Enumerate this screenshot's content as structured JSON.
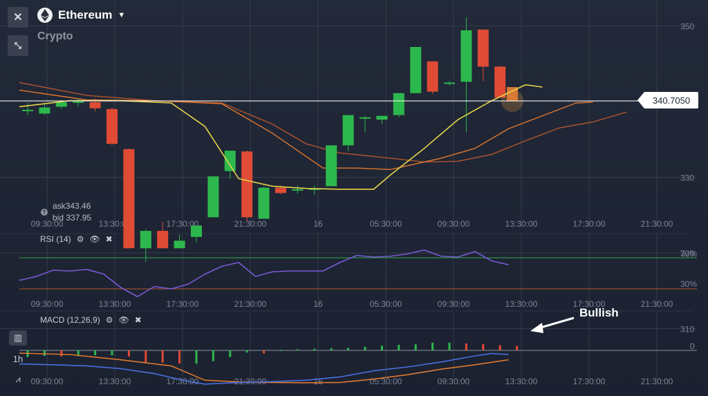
{
  "asset": {
    "name": "Ethereum",
    "category": "Crypto"
  },
  "toolbar": {
    "close_icon": "close-icon",
    "collapse_icon": "collapse-arrows-icon"
  },
  "quotes": {
    "ask": "ask343.46",
    "bid": "bid 337.95"
  },
  "current_price": "340.7050",
  "price_axis": {
    "ticks": [
      "350",
      "340",
      "330",
      "320",
      "310"
    ]
  },
  "time_axis": {
    "labels": [
      "09:30:00",
      "13:30:00",
      "17:30:00",
      "21:30:00",
      "16",
      "05:30:00",
      "09:30:00",
      "13:30:00",
      "17:30:00",
      "21:30:00"
    ]
  },
  "rsi": {
    "title": "RSI (14)",
    "levels": [
      "70%",
      "30%"
    ],
    "line_color": "#7a5ad6"
  },
  "macd": {
    "title": "MACD (12,26,9)",
    "zero_label": "0"
  },
  "annotation": {
    "text": "Bullish"
  },
  "sidebar": {
    "timeframe": "1h"
  },
  "colors": {
    "up": "#2db84d",
    "down": "#e04b35",
    "yellow": "#e6d44a",
    "orange": "#e0782f",
    "blue": "#4a6fe0"
  },
  "chart_data": {
    "type": "candlestick",
    "candles": [
      {
        "o": 339.0,
        "h": 340.0,
        "c": 339.1,
        "l": 338.4
      },
      {
        "o": 338.6,
        "h": 339.9,
        "c": 339.4,
        "l": 338.4
      },
      {
        "o": 339.5,
        "h": 340.4,
        "c": 340.1,
        "l": 339.2
      },
      {
        "o": 340.2,
        "h": 340.6,
        "c": 340.2,
        "l": 339.6
      },
      {
        "o": 340.1,
        "h": 340.6,
        "c": 339.3,
        "l": 338.9
      },
      {
        "o": 339.2,
        "h": 339.4,
        "c": 334.6,
        "l": 334.4
      },
      {
        "o": 333.9,
        "h": 334.0,
        "c": 320.8,
        "l": 320.8
      },
      {
        "o": 320.8,
        "h": 323.3,
        "c": 323.1,
        "l": 319.0
      },
      {
        "o": 323.1,
        "h": 324.3,
        "c": 320.8,
        "l": 320.8
      },
      {
        "o": 320.8,
        "h": 322.6,
        "c": 321.8,
        "l": 320.8
      },
      {
        "o": 322.3,
        "h": 323.8,
        "c": 323.8,
        "l": 321.6
      },
      {
        "o": 324.9,
        "h": 330.3,
        "c": 330.3,
        "l": 324.9
      },
      {
        "o": 331.0,
        "h": 333.7,
        "c": 333.7,
        "l": 330.0
      },
      {
        "o": 333.6,
        "h": 333.7,
        "c": 324.9,
        "l": 324.4
      },
      {
        "o": 324.7,
        "h": 329.0,
        "c": 328.8,
        "l": 324.7
      },
      {
        "o": 328.8,
        "h": 329.1,
        "c": 328.1,
        "l": 327.9
      },
      {
        "o": 328.5,
        "h": 329.1,
        "c": 328.6,
        "l": 328.0
      },
      {
        "o": 328.7,
        "h": 329.1,
        "c": 328.7,
        "l": 327.9
      },
      {
        "o": 329.0,
        "h": 334.4,
        "c": 334.4,
        "l": 329.0
      },
      {
        "o": 334.4,
        "h": 338.4,
        "c": 338.4,
        "l": 333.6
      },
      {
        "o": 338.1,
        "h": 338.3,
        "c": 338.1,
        "l": 336.1
      },
      {
        "o": 337.8,
        "h": 338.3,
        "c": 338.3,
        "l": 337.2
      },
      {
        "o": 338.4,
        "h": 341.3,
        "c": 341.3,
        "l": 338.1
      },
      {
        "o": 341.3,
        "h": 347.4,
        "c": 347.4,
        "l": 341.3
      },
      {
        "o": 345.5,
        "h": 345.5,
        "c": 341.5,
        "l": 341.2
      },
      {
        "o": 342.7,
        "h": 342.9,
        "c": 342.7,
        "l": 342.3
      },
      {
        "o": 342.8,
        "h": 351.3,
        "c": 349.6,
        "l": 336.1
      },
      {
        "o": 349.7,
        "h": 349.7,
        "c": 344.8,
        "l": 342.9
      },
      {
        "o": 344.8,
        "h": 344.9,
        "c": 340.7,
        "l": 340.7
      }
    ],
    "ma_fast": [
      [
        0,
        339.5
      ],
      [
        3,
        340.3
      ],
      [
        6,
        340.3
      ],
      [
        9,
        340.0
      ],
      [
        11,
        336.9
      ],
      [
        13,
        330.0
      ],
      [
        15,
        329.0
      ],
      [
        17,
        328.7
      ],
      [
        19,
        328.6
      ],
      [
        21,
        328.6
      ],
      [
        22,
        330.5
      ],
      [
        24,
        334.0
      ],
      [
        26,
        337.8
      ],
      [
        28,
        340.3
      ],
      [
        30,
        342.4
      ],
      [
        31,
        342.1
      ]
    ],
    "ma_mid": [
      [
        0,
        341.7
      ],
      [
        4,
        340.4
      ],
      [
        8,
        340.3
      ],
      [
        12,
        339.9
      ],
      [
        15,
        336.0
      ],
      [
        18,
        331.4
      ],
      [
        20,
        331.4
      ],
      [
        22,
        331.2
      ],
      [
        25,
        332.7
      ],
      [
        27,
        334.0
      ],
      [
        29,
        336.6
      ],
      [
        31,
        338.3
      ],
      [
        33,
        340.0
      ],
      [
        34,
        340.1
      ]
    ],
    "ma_slow": [
      [
        0,
        342.7
      ],
      [
        4,
        341.0
      ],
      [
        8,
        340.3
      ],
      [
        12,
        340.0
      ],
      [
        15,
        337.2
      ],
      [
        17,
        334.6
      ],
      [
        19,
        333.4
      ],
      [
        22,
        332.7
      ],
      [
        24,
        332.2
      ],
      [
        26,
        332.3
      ],
      [
        28,
        333.2
      ],
      [
        30,
        335.0
      ],
      [
        32,
        336.7
      ],
      [
        34,
        337.5
      ],
      [
        36,
        338.8
      ]
    ],
    "rsi_values": [
      [
        0,
        41
      ],
      [
        1,
        46
      ],
      [
        2,
        54
      ],
      [
        3,
        53
      ],
      [
        4,
        55
      ],
      [
        5,
        49
      ],
      [
        6,
        32
      ],
      [
        7,
        20
      ],
      [
        8,
        33
      ],
      [
        9,
        30
      ],
      [
        10,
        36
      ],
      [
        11,
        49
      ],
      [
        12,
        59
      ],
      [
        13,
        64
      ],
      [
        14,
        46
      ],
      [
        15,
        52
      ],
      [
        16,
        53
      ],
      [
        17,
        53
      ],
      [
        18,
        53
      ],
      [
        19,
        64
      ],
      [
        20,
        73
      ],
      [
        21,
        71
      ],
      [
        22,
        72
      ],
      [
        23,
        75
      ],
      [
        24,
        80
      ],
      [
        25,
        72
      ],
      [
        26,
        71
      ],
      [
        27,
        78
      ],
      [
        28,
        66
      ],
      [
        29,
        61
      ]
    ],
    "macd_line": [
      [
        0,
        -4.9
      ],
      [
        2,
        -5.2
      ],
      [
        4,
        -5.6
      ],
      [
        6,
        -6.6
      ],
      [
        8,
        -8.4
      ],
      [
        10,
        -11.2
      ],
      [
        11,
        -12.2
      ],
      [
        13,
        -11.6
      ],
      [
        15,
        -11.3
      ],
      [
        17,
        -10.8
      ],
      [
        19,
        -9.6
      ],
      [
        21,
        -7.4
      ],
      [
        23,
        -6.0
      ],
      [
        25,
        -4.2
      ],
      [
        27,
        -2.0
      ],
      [
        28,
        -1.1
      ],
      [
        29,
        -1.5
      ]
    ],
    "signal_line": [
      [
        0,
        -1.0
      ],
      [
        3,
        -1.5
      ],
      [
        6,
        -3.4
      ],
      [
        9,
        -5.6
      ],
      [
        11,
        -10.8
      ],
      [
        13,
        -11.4
      ],
      [
        15,
        -11.6
      ],
      [
        17,
        -11.7
      ],
      [
        19,
        -11.6
      ],
      [
        21,
        -10.4
      ],
      [
        23,
        -8.8
      ],
      [
        25,
        -6.8
      ],
      [
        27,
        -5.2
      ],
      [
        29,
        -3.4
      ]
    ],
    "histogram": [
      -2.4,
      -2.0,
      -2.2,
      -2.1,
      -1.8,
      -1.8,
      -2.2,
      -4.3,
      -4.4,
      -4.8,
      -4.8,
      -3.9,
      -2.4,
      -0.8,
      -1.1,
      0.0,
      0.4,
      0.6,
      0.8,
      0.9,
      1.3,
      1.7,
      2.0,
      2.2,
      2.8,
      2.8,
      2.5,
      2.3,
      1.9,
      1.6
    ]
  }
}
